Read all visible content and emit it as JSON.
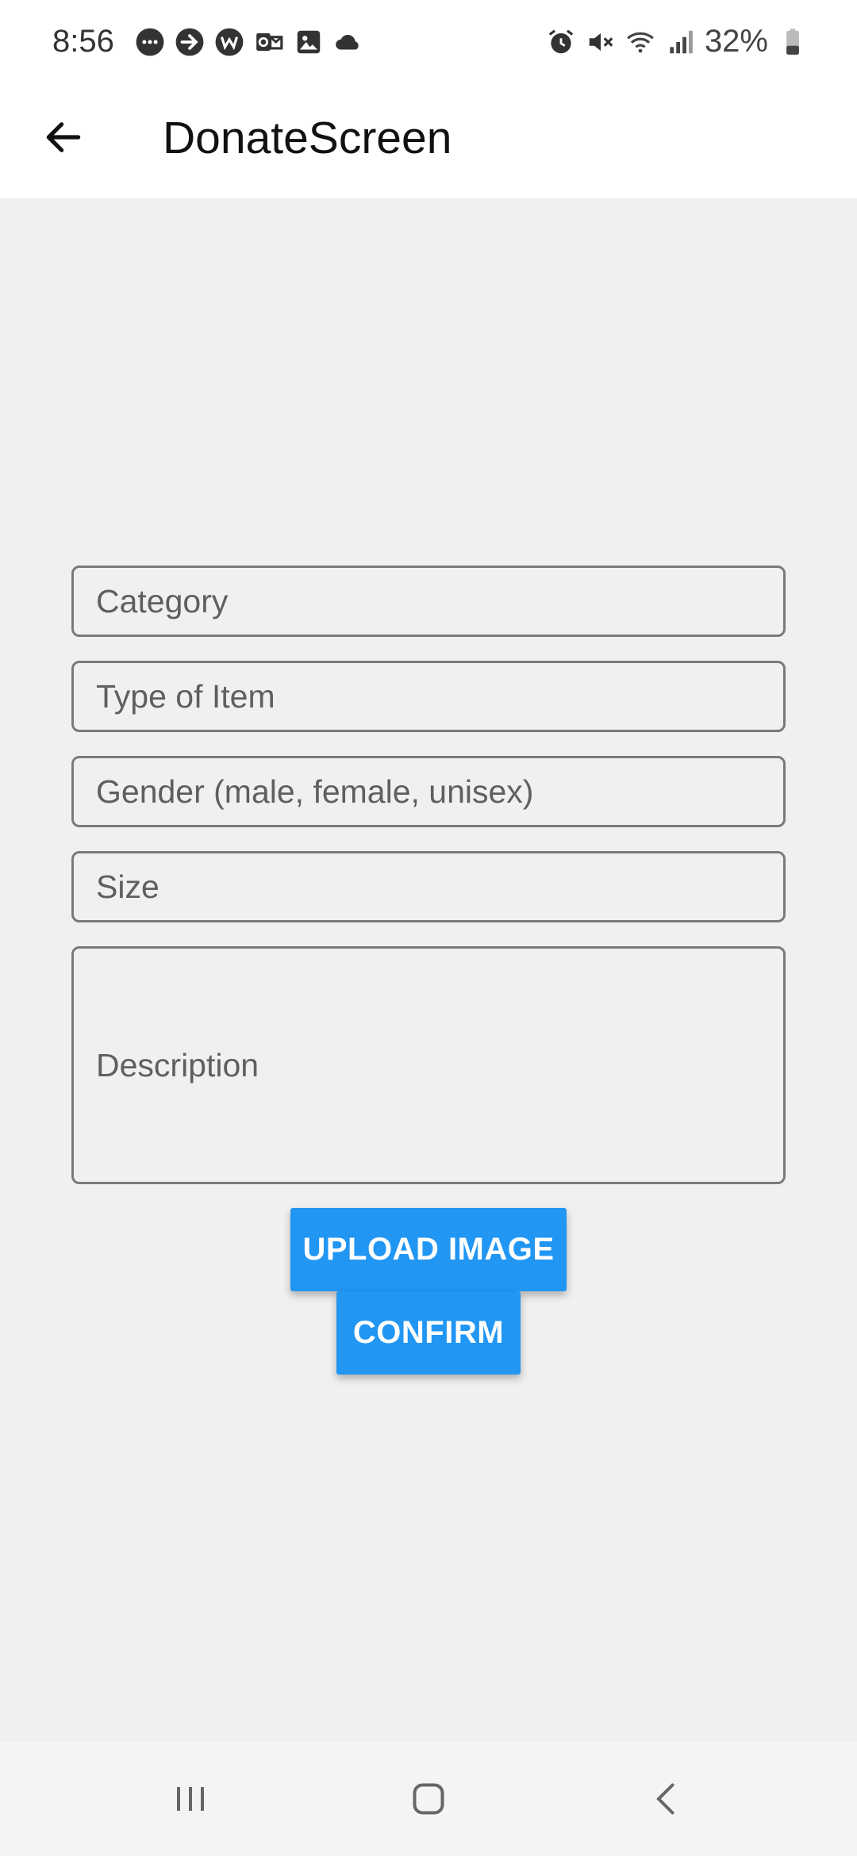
{
  "status_bar": {
    "time": "8:56",
    "battery": "32%",
    "left_icons": [
      "chat-bubble-icon",
      "forward-arrow-icon",
      "w-badge-icon",
      "outlook-icon",
      "image-icon",
      "cloud-icon"
    ],
    "right_icons": [
      "alarm-icon",
      "mute-icon",
      "wifi-icon",
      "signal-icon",
      "battery-icon"
    ]
  },
  "app_bar": {
    "title": "DonateScreen",
    "back_icon": "arrow-left-icon"
  },
  "form": {
    "category_placeholder": "Category",
    "type_placeholder": "Type of Item",
    "gender_placeholder": "Gender (male, female, unisex)",
    "size_placeholder": "Size",
    "description_placeholder": "Description"
  },
  "buttons": {
    "upload_label": "UPLOAD IMAGE",
    "confirm_label": "CONFIRM"
  },
  "nav_bar": {
    "icons": [
      "recent-apps-icon",
      "home-icon",
      "back-icon"
    ]
  },
  "colors": {
    "primary": "#2196f3",
    "background": "#f0f0f0",
    "surface": "#ffffff"
  }
}
